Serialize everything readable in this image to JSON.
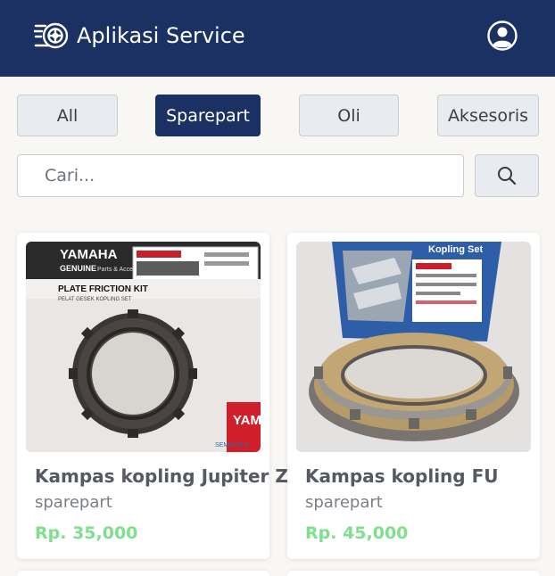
{
  "navbar": {
    "brand_title": "Aplikasi Service",
    "brand_icon": "wheel-speed-icon",
    "user_icon": "user-circle-icon",
    "background": "#1c3163"
  },
  "categories": {
    "items": [
      "All",
      "Sparepart",
      "Oli",
      "Aksesoris"
    ],
    "active": "Sparepart"
  },
  "search": {
    "placeholder": "Cari...",
    "value": "",
    "button_icon": "search-icon"
  },
  "products": [
    {
      "name": "Kampas kopling Jupiter Z",
      "category": "sparepart",
      "price": "Rp. 35,000",
      "image_texts": {
        "brand": "YAMAHA",
        "genuine": "GENUINE",
        "subtitle": "Parts & Accessories",
        "kit": "PLATE FRICTION KIT",
        "kit_sub": "PELAT GESEK KOPLING SET",
        "side_brand": "YAMA",
        "tagline": "SEMAKIN D"
      }
    },
    {
      "name": "Kampas kopling FU",
      "category": "sparepart",
      "price": "Rp. 45,000",
      "image_texts": {
        "box_title": "Kopling Set"
      }
    }
  ],
  "colors": {
    "accent": "#1c3163",
    "price": "#7ee08f",
    "page_bg": "#f8f7f4"
  }
}
